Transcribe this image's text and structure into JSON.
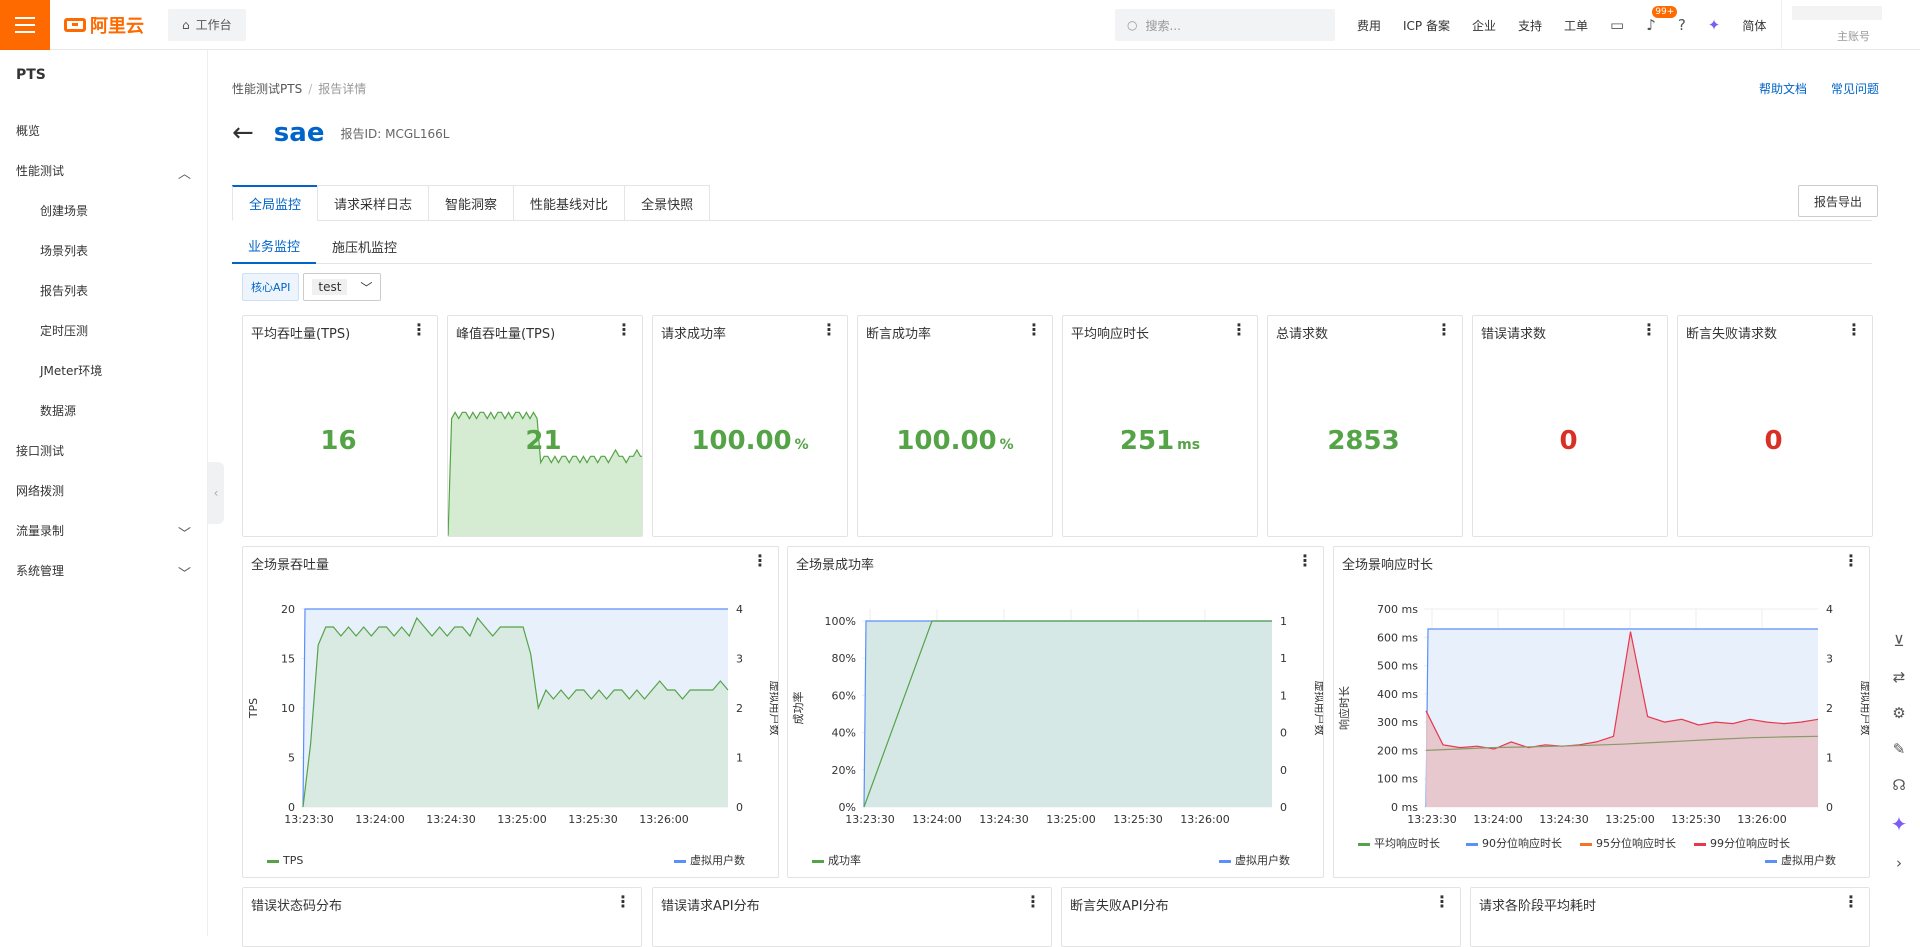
{
  "topbar": {
    "logo": "阿里云",
    "workspace": "工作台",
    "search_placeholder": "搜索...",
    "nav": [
      "费用",
      "ICP 备案",
      "企业",
      "支持",
      "工单"
    ],
    "badge": "99+",
    "lang": "简体",
    "account_sub": "主账号"
  },
  "sidebar": {
    "product": "PTS",
    "items": [
      {
        "label": "概览"
      },
      {
        "label": "性能测试"
      },
      {
        "label": "创建场景"
      },
      {
        "label": "场景列表"
      },
      {
        "label": "报告列表"
      },
      {
        "label": "定时压测"
      },
      {
        "label": "JMeter环境"
      },
      {
        "label": "数据源"
      },
      {
        "label": "接口测试"
      },
      {
        "label": "网络拨测"
      },
      {
        "label": "流量录制"
      },
      {
        "label": "系统管理"
      }
    ]
  },
  "breadcrumb": {
    "root": "性能测试PTS",
    "current": "报告详情"
  },
  "links": {
    "help": "帮助文档",
    "faq": "常见问题"
  },
  "report": {
    "title": "sae",
    "id_label": "报告ID:",
    "id": "MCGL166L"
  },
  "tabs": [
    "全局监控",
    "请求采样日志",
    "智能洞察",
    "性能基线对比",
    "全景快照"
  ],
  "export_label": "报告导出",
  "subtabs": [
    "业务监控",
    "施压机监控"
  ],
  "filter": {
    "chip": "核心API",
    "select": "test"
  },
  "kpis": [
    {
      "title": "平均吞吐量(TPS)",
      "value": "16",
      "unit": "",
      "color": "#55a347"
    },
    {
      "title": "峰值吞吐量(TPS)",
      "value": "21",
      "unit": "",
      "color": "#55a347"
    },
    {
      "title": "请求成功率",
      "value": "100.00",
      "unit": "%",
      "color": "#55a347"
    },
    {
      "title": "断言成功率",
      "value": "100.00",
      "unit": "%",
      "color": "#55a347"
    },
    {
      "title": "平均响应时长",
      "value": "251",
      "unit": "ms",
      "color": "#55a347"
    },
    {
      "title": "总请求数",
      "value": "2853",
      "unit": "",
      "color": "#55a347"
    },
    {
      "title": "错误请求数",
      "value": "0",
      "unit": "",
      "color": "#d93026"
    },
    {
      "title": "断言失败请求数",
      "value": "0",
      "unit": "",
      "color": "#d93026"
    }
  ],
  "charts": [
    {
      "title": "全场景吞吐量",
      "y_label": "TPS",
      "y2_label": "虚拟用户数"
    },
    {
      "title": "全场景成功率",
      "y_label": "成功率",
      "y2_label": "虚拟用户数"
    },
    {
      "title": "全场景响应时长",
      "y_label": "响应时长",
      "y2_label": "虚拟用户数"
    }
  ],
  "bottom_cards": [
    "错误状态码分布",
    "错误请求API分布",
    "断言失败API分布",
    "请求各阶段平均耗时"
  ],
  "chart_data": [
    {
      "type": "line",
      "title": "全场景吞吐量",
      "x": [
        "13:23:30",
        "13:24:00",
        "13:24:30",
        "13:25:00",
        "13:25:30",
        "13:26:00"
      ],
      "ylim": [
        0,
        22
      ],
      "y_ticks": [
        0,
        5,
        10,
        15,
        20
      ],
      "y2lim": [
        0,
        4
      ],
      "y2_ticks": [
        0,
        1,
        2,
        3,
        4
      ],
      "series": [
        {
          "name": "TPS",
          "color": "#55a347",
          "values": [
            0,
            7,
            18,
            20,
            20,
            19,
            20,
            19,
            20,
            19,
            20,
            20,
            19,
            20,
            19,
            21,
            20,
            19,
            20,
            19,
            20,
            20,
            19,
            21,
            20,
            19,
            20,
            20,
            20,
            20,
            17,
            11,
            13,
            12,
            13,
            12,
            13,
            13,
            12,
            13,
            12,
            13,
            13,
            12,
            13,
            12,
            13,
            14,
            13,
            13,
            12,
            13,
            13,
            13,
            13,
            14,
            13
          ]
        },
        {
          "name": "虚拟用户数",
          "color": "#5b8ff9",
          "axis": "right",
          "values": [
            0,
            4,
            4,
            4,
            4,
            4,
            4,
            4
          ]
        }
      ],
      "legend": [
        "TPS",
        "虚拟用户数"
      ]
    },
    {
      "type": "area",
      "title": "全场景成功率",
      "x": [
        "13:23:30",
        "13:24:00",
        "13:24:30",
        "13:25:00",
        "13:25:30",
        "13:26:00"
      ],
      "y_ticks": [
        "0%",
        "20%",
        "40%",
        "60%",
        "80%",
        "100%"
      ],
      "y2_ticks": [
        0,
        0,
        0,
        1,
        1,
        1
      ],
      "series": [
        {
          "name": "成功率",
          "color": "#55a347",
          "values": [
            0,
            100,
            100,
            100,
            100,
            100,
            100
          ]
        },
        {
          "name": "虚拟用户数",
          "color": "#5b8ff9",
          "axis": "right",
          "values": [
            0,
            1,
            1,
            1,
            1,
            1,
            1
          ]
        }
      ],
      "legend": [
        "成功率",
        "虚拟用户数"
      ]
    },
    {
      "type": "line",
      "title": "全场景响应时长",
      "x": [
        "13:23:30",
        "13:24:00",
        "13:24:30",
        "13:25:00",
        "13:25:30",
        "13:26:00"
      ],
      "y_ticks": [
        "0 ms",
        "100 ms",
        "200 ms",
        "300 ms",
        "400 ms",
        "500 ms",
        "600 ms",
        "700 ms"
      ],
      "ylim": [
        0,
        700
      ],
      "y2_ticks": [
        0,
        1,
        2,
        3,
        4
      ],
      "y2lim": [
        0,
        4
      ],
      "series": [
        {
          "name": "平均响应时长",
          "color": "#55a347",
          "values": [
            200,
            205,
            210,
            212,
            215,
            218,
            222,
            228,
            234,
            240,
            245,
            248,
            250
          ]
        },
        {
          "name": "90分位响应时长",
          "color": "#5b8ff9",
          "values": []
        },
        {
          "name": "95分位响应时长",
          "color": "#f5722b",
          "values": []
        },
        {
          "name": "99分位响应时长",
          "color": "#e8384f",
          "values": [
            340,
            220,
            210,
            215,
            205,
            230,
            210,
            220,
            215,
            220,
            230,
            250,
            620,
            320,
            300,
            310,
            290,
            300,
            295,
            310,
            300,
            295,
            300,
            310
          ]
        },
        {
          "name": "虚拟用户数",
          "color": "#5b8ff9",
          "axis": "right",
          "values": [
            0,
            4,
            4,
            4,
            4,
            4,
            4
          ]
        }
      ],
      "legend": [
        "平均响应时长",
        "90分位响应时长",
        "95分位响应时长",
        "99分位响应时长",
        "虚拟用户数"
      ]
    }
  ]
}
